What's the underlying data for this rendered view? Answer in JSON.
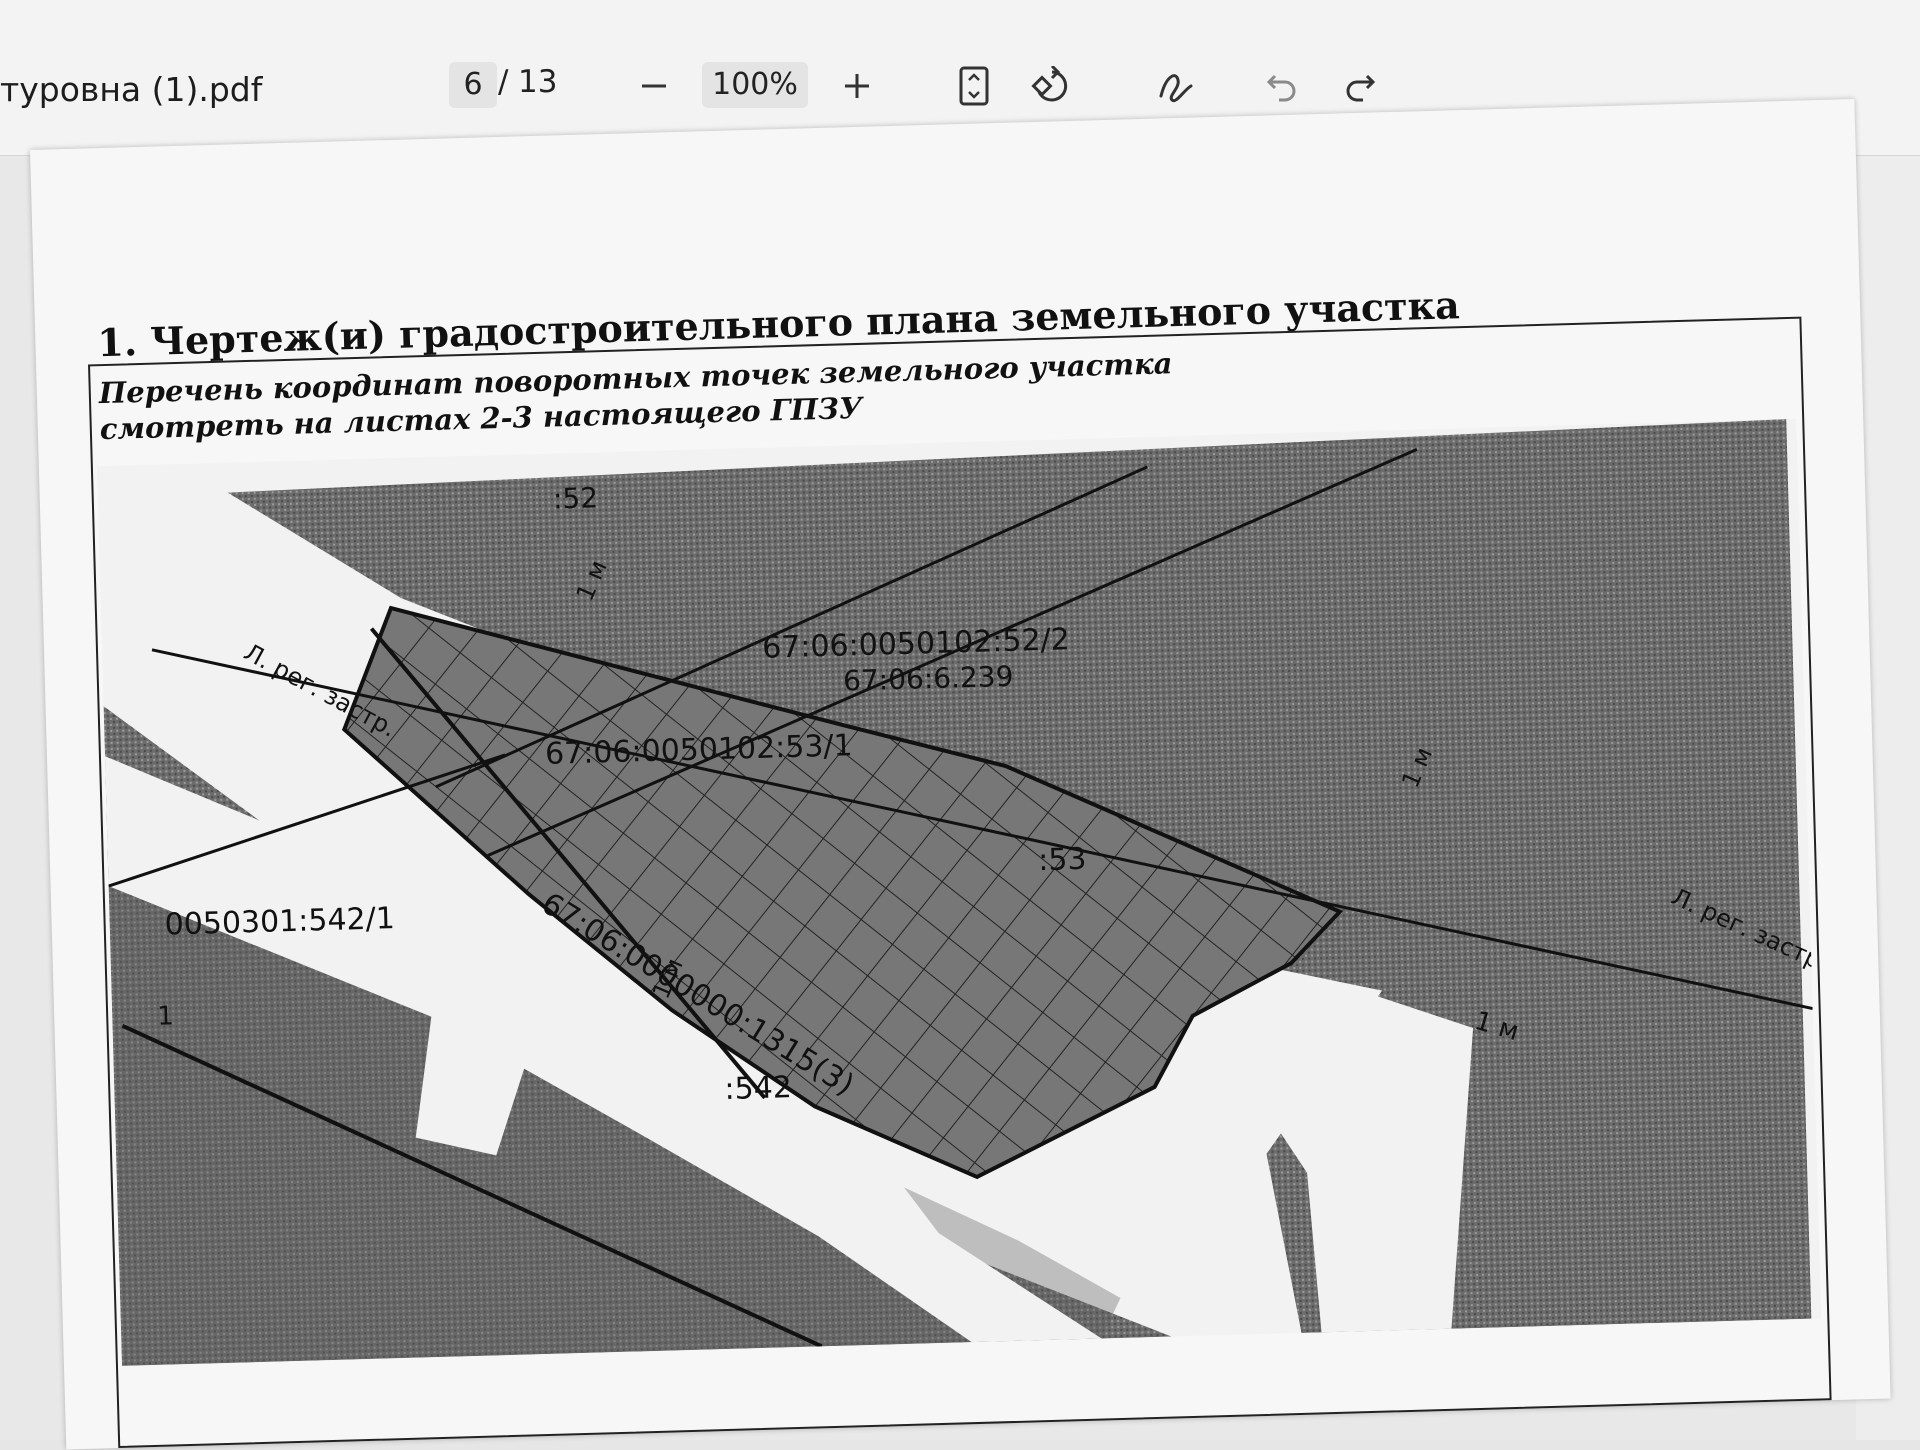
{
  "toolbar": {
    "file_name": "туровна (1).pdf",
    "current_page": "6",
    "page_separator": "/",
    "total_pages": "13",
    "zoom_level": "100%",
    "zoom_out_label": "−",
    "zoom_in_label": "+",
    "icons": {
      "zoom_out": "minus-icon",
      "zoom_in": "plus-icon",
      "fit_page": "fit-page-icon",
      "rotate": "rotate-icon",
      "draw": "draw-icon",
      "undo": "undo-icon",
      "redo": "redo-icon"
    }
  },
  "document": {
    "heading": "1. Чертеж(и) градостроительного плана земельного участка",
    "note_line1": "Перечень координат поворотных точек земельного участка",
    "note_line2": "смотреть на листах 2-3 настоящего ГПЗУ",
    "map_labels": {
      "plot_52": ":52",
      "plot_53": ":53",
      "plot_542": ":542",
      "cadastral_52_2": "67:06:0050102:52/2",
      "cadastral_6_239": "67:06:6.239",
      "cadastral_53_1": "67:06:0050102:53/1",
      "cadastral_542_1": "0050301:542/1",
      "cadastral_road": "67:06:0000000:1315(3)",
      "reg_line_left": "Л. рег. застр.",
      "reg_line_right": "Л. рег. застр.",
      "offset_1m_a": "1 м",
      "offset_1m_b": "1 м",
      "offset_1m_c": "1 м",
      "offset_1m_d": "1 м",
      "edge_number": "1"
    }
  }
}
